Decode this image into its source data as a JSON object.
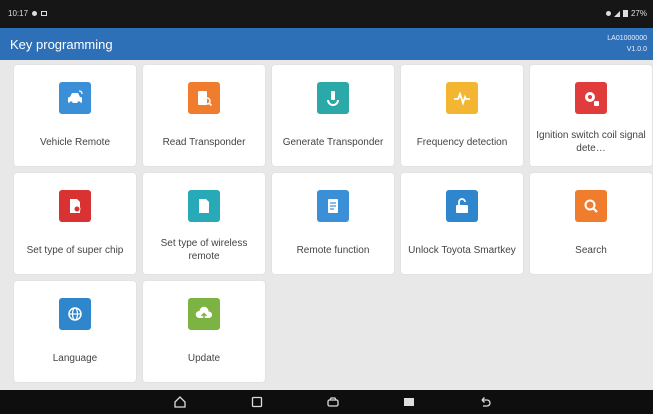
{
  "status_bar": {
    "time": "10:17",
    "battery": "27%"
  },
  "app_bar": {
    "title": "Key programming",
    "serial": "LA01000000",
    "version": "V1.0.0"
  },
  "colors": {
    "accent": "#2d70b8",
    "background": "#e8e8e8"
  },
  "tiles": [
    {
      "label": "Vehicle Remote",
      "icon": "car-remote-icon",
      "color": "#3a8fd6"
    },
    {
      "label": "Read Transponder",
      "icon": "read-transponder-icon",
      "color": "#ef7d2d"
    },
    {
      "label": "Generate Transponder",
      "icon": "generate-transponder-icon",
      "color": "#2ba8a8"
    },
    {
      "label": "Frequency detection",
      "icon": "frequency-wave-icon",
      "color": "#f2b632"
    },
    {
      "label": "Ignition switch coil signal dete…",
      "icon": "ignition-coil-icon",
      "color": "#e03c3c"
    },
    {
      "label": "Set type of super chip",
      "icon": "super-chip-icon",
      "color": "#d93232"
    },
    {
      "label": "Set type of wireless remote",
      "icon": "wireless-remote-icon",
      "color": "#27a9b8"
    },
    {
      "label": "Remote function",
      "icon": "remote-function-icon",
      "color": "#3a8fd6"
    },
    {
      "label": "Unlock Toyota Smartkey",
      "icon": "unlock-icon",
      "color": "#2f86cc"
    },
    {
      "label": "Search",
      "icon": "search-icon",
      "color": "#ef7d2d"
    },
    {
      "label": "Language",
      "icon": "globe-icon",
      "color": "#2f86cc"
    },
    {
      "label": "Update",
      "icon": "cloud-upload-icon",
      "color": "#7cb342"
    }
  ],
  "nav_bar": [
    "home-icon",
    "recent-apps-icon",
    "vci-icon",
    "screenshot-icon",
    "back-icon"
  ]
}
